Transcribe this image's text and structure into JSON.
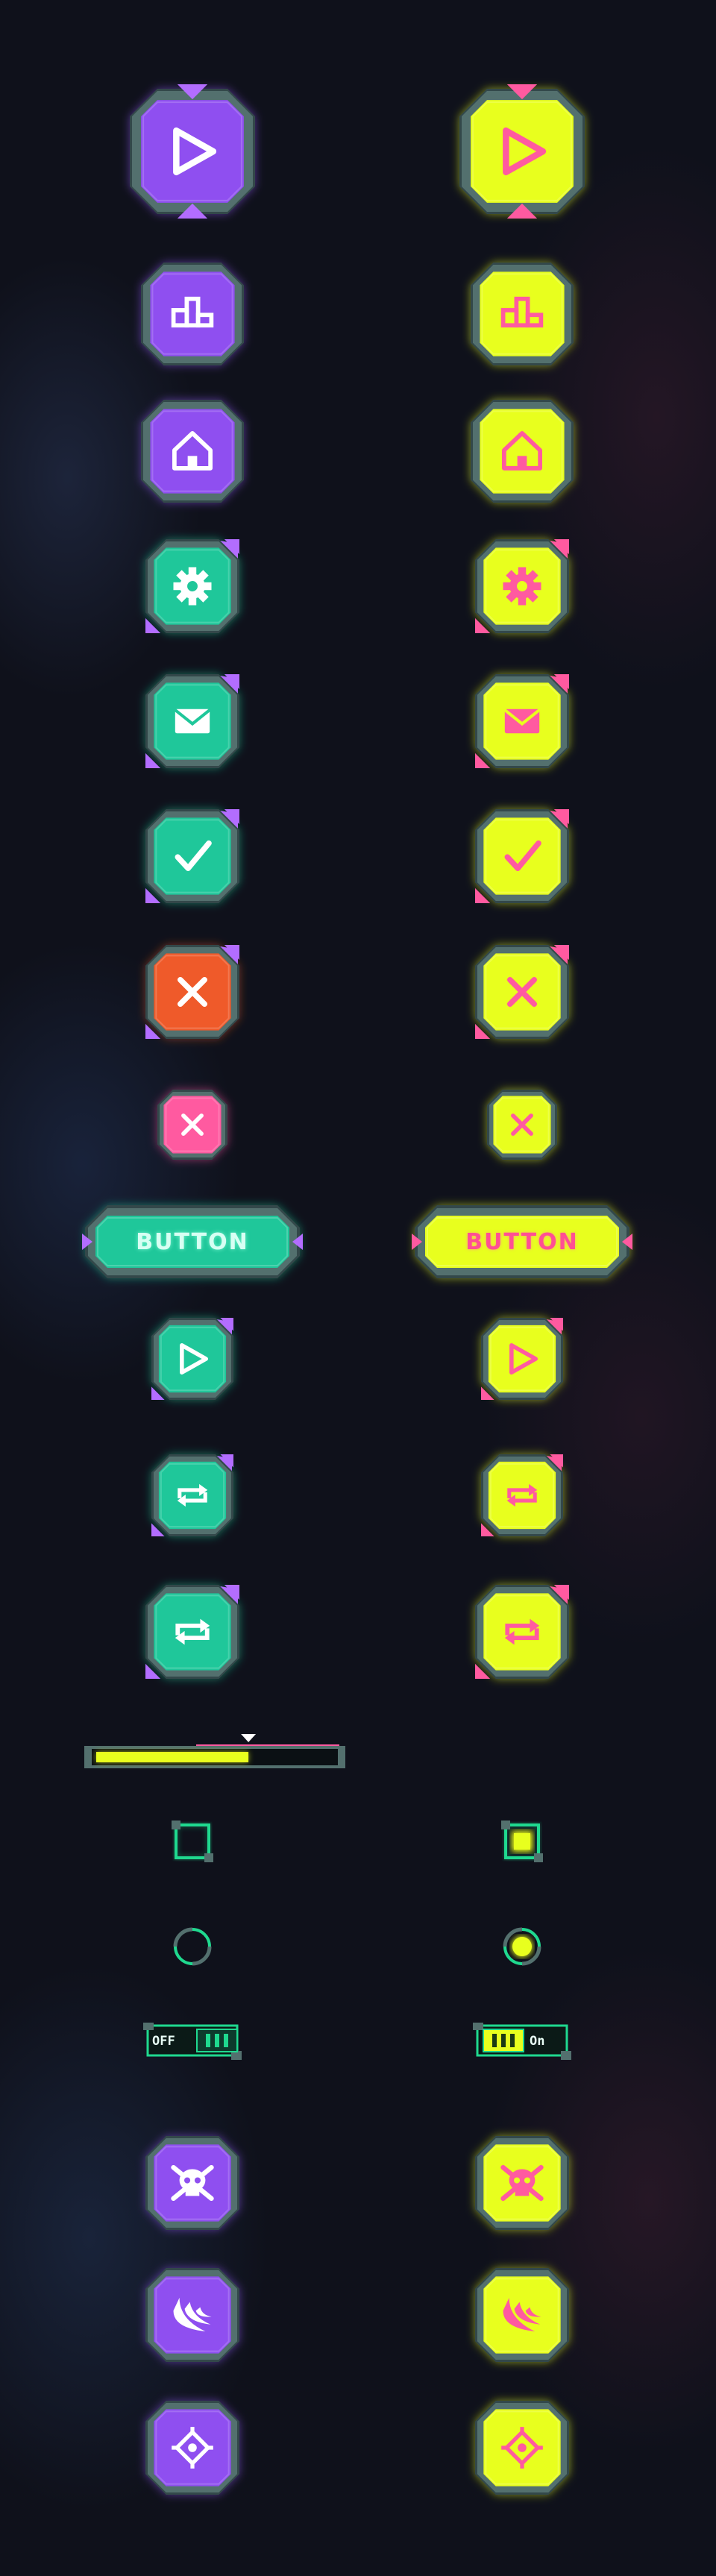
{
  "colors": {
    "purple": "#8f4ff0",
    "green": "#1fc79a",
    "yellow": "#e8ff1e",
    "red": "#ef5a2a",
    "pink": "#ff5aa0",
    "frame": "#53706e",
    "frame_dark": "#33484a",
    "accent_purple": "#b36dff"
  },
  "buttons": {
    "large_label": "BUTTON"
  },
  "rows": [
    {
      "id": "play-large",
      "icon": "play-icon"
    },
    {
      "id": "leaderboard",
      "icon": "podium-icon"
    },
    {
      "id": "home",
      "icon": "home-icon"
    },
    {
      "id": "settings",
      "icon": "gear-icon"
    },
    {
      "id": "mail",
      "icon": "mail-icon"
    },
    {
      "id": "confirm",
      "icon": "check-icon"
    },
    {
      "id": "cancel",
      "icon": "close-icon"
    },
    {
      "id": "close-small",
      "icon": "close-icon"
    },
    {
      "id": "text-button",
      "icon": "none"
    },
    {
      "id": "play-small",
      "icon": "play-icon"
    },
    {
      "id": "repeat-small",
      "icon": "repeat-icon"
    },
    {
      "id": "repeat-medium",
      "icon": "repeat-icon"
    },
    {
      "id": "skull",
      "icon": "skull-icon"
    },
    {
      "id": "claw",
      "icon": "claw-icon"
    },
    {
      "id": "target",
      "icon": "crosshair-icon"
    }
  ],
  "progress": {
    "value": 0.65
  },
  "checkbox": {
    "left_checked": false,
    "right_checked": true
  },
  "radio": {
    "left_selected": false,
    "right_selected": true
  },
  "toggle": {
    "off_label": "OFF",
    "on_label": "On"
  }
}
